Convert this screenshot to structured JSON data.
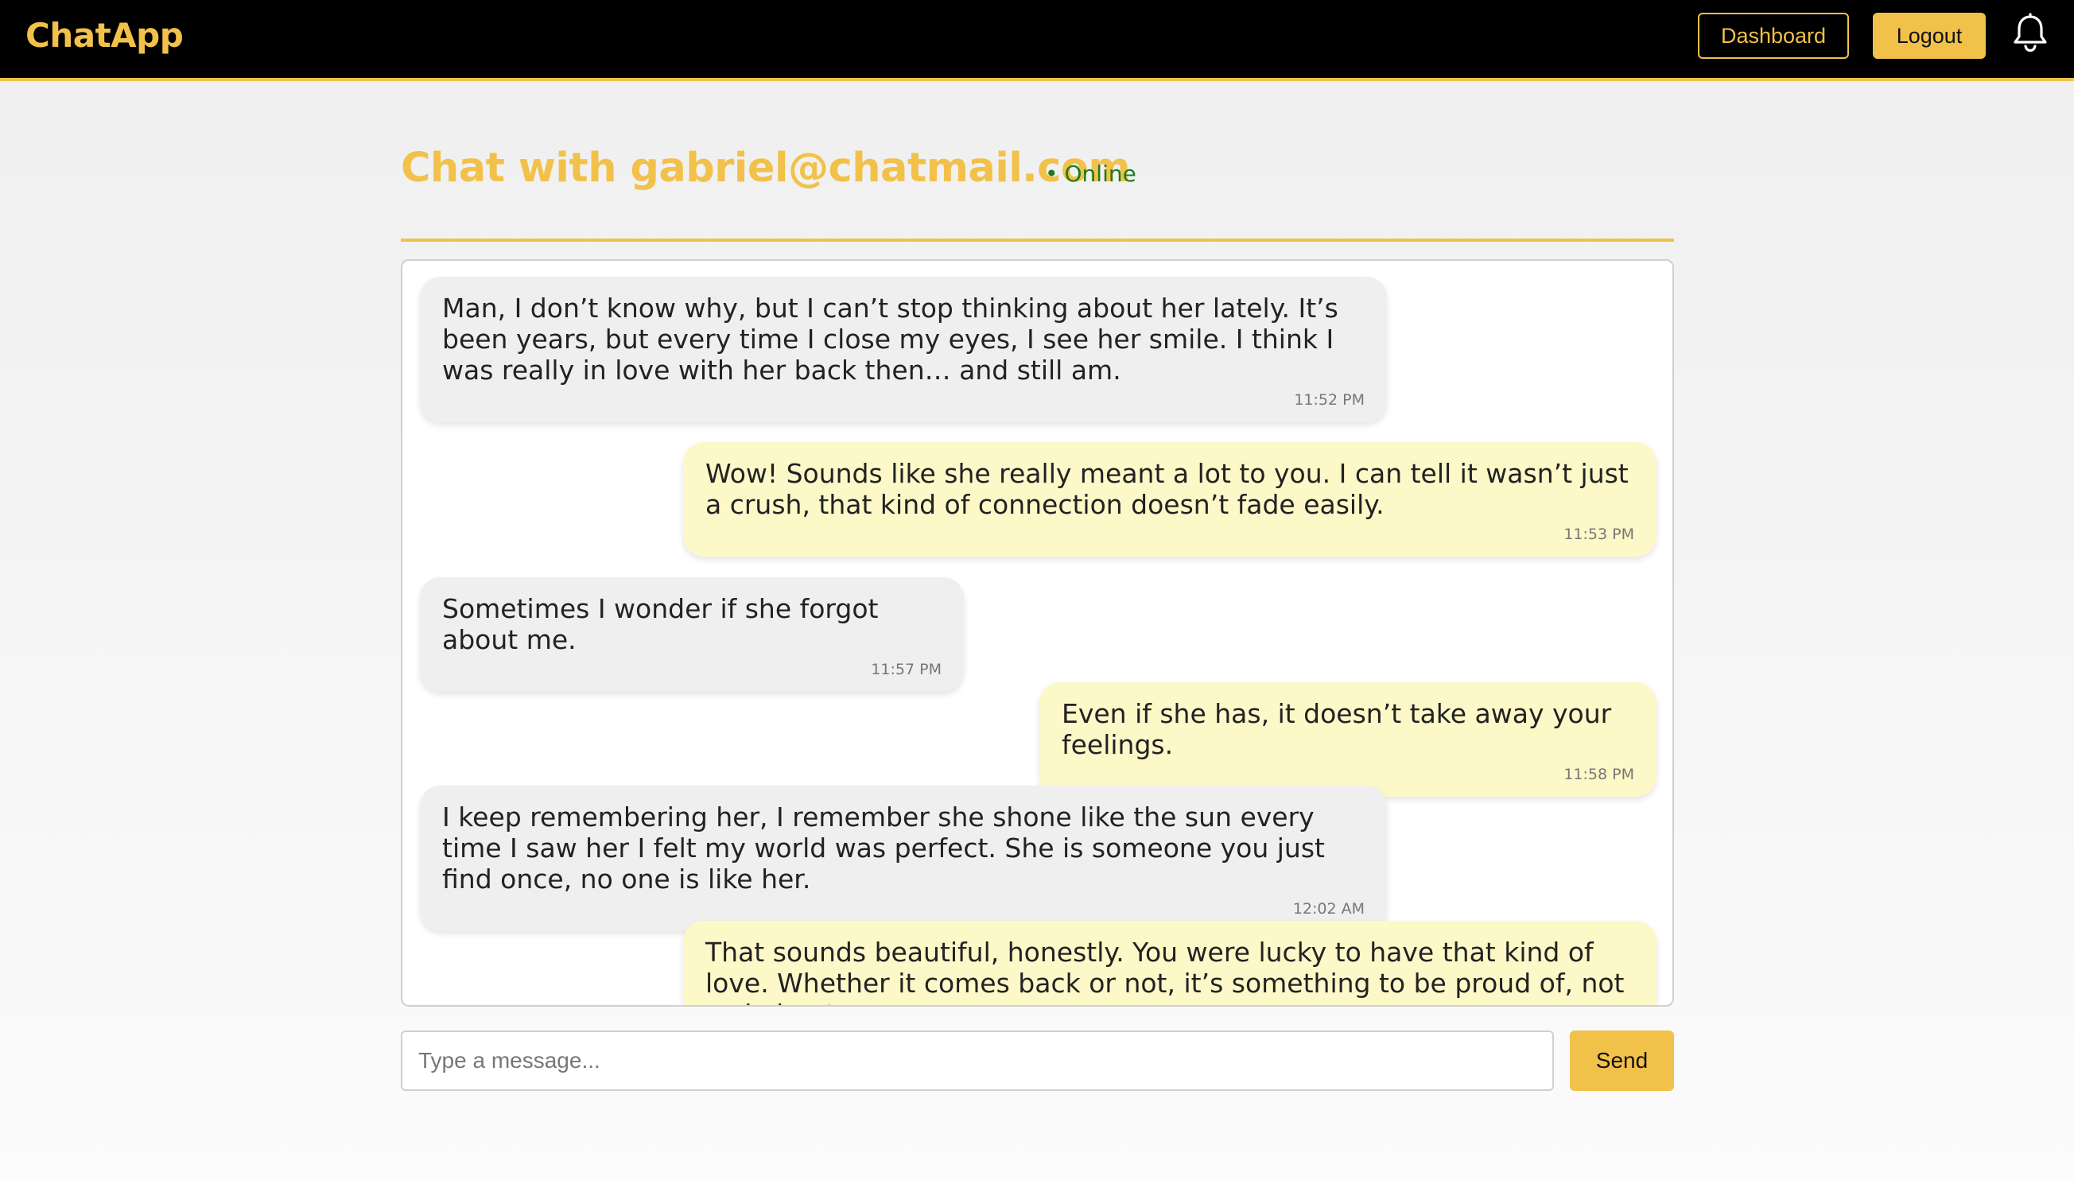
{
  "navbar": {
    "brand": "ChatApp",
    "dashboard_label": "Dashboard",
    "logout_label": "Logout",
    "notification_icon": "bell-icon"
  },
  "chat": {
    "title": "Chat with gabriel@chatmail.com",
    "status_dot": "•",
    "status": "Online",
    "messages": [
      {
        "direction": "in",
        "text": "Man, I don’t know why, but I can’t stop thinking about her lately. It’s been years, but every time I close my eyes, I see her smile. I think I was really in love with her back then… and still am.",
        "time": "11:52 PM"
      },
      {
        "direction": "out",
        "text": "Wow! Sounds like she really meant a lot to you. I can tell it wasn’t just a crush, that kind of connection doesn’t fade easily.",
        "time": "11:53 PM"
      },
      {
        "direction": "in",
        "text": "Sometimes I wonder if she forgot about me.",
        "time": "11:57 PM"
      },
      {
        "direction": "out",
        "text": "Even if she has, it doesn’t take away your feelings.",
        "time": "11:58 PM"
      },
      {
        "direction": "in",
        "text": "I keep remembering her, I remember she shone like the sun every time I saw her I felt my world was perfect. She is someone you just find once, no one is like her.",
        "time": "12:02 AM"
      },
      {
        "direction": "out",
        "text": "That sounds beautiful, honestly. You were lucky to have that kind of love. Whether it comes back or not, it’s something to be proud of, not sad about.",
        "time": ""
      }
    ]
  },
  "composer": {
    "placeholder": "Type a message...",
    "value": "",
    "send_label": "Send"
  },
  "colors": {
    "accent": "#f2c14a",
    "navbar_bg": "#000000",
    "incoming_bubble": "#efefef",
    "outgoing_bubble": "#fdf8c8",
    "online": "#1f7a1f"
  }
}
